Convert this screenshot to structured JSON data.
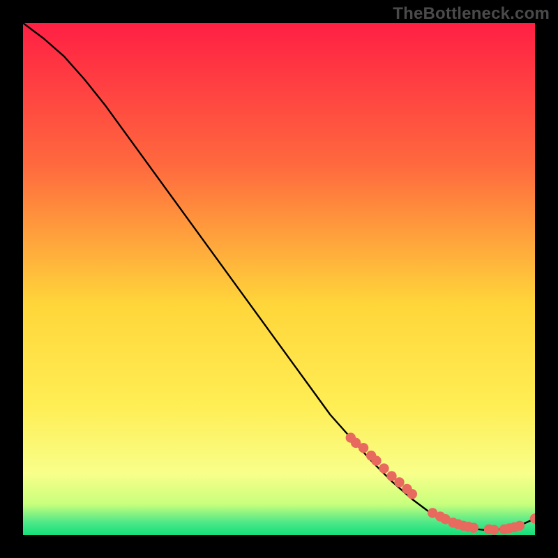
{
  "watermark": "TheBottleneck.com",
  "colors": {
    "gradient_top": "#ff1f44",
    "gradient_mid1": "#ff7a3a",
    "gradient_mid2": "#ffd63a",
    "gradient_mid3": "#fff56a",
    "gradient_bottom_yellow": "#f8ff8a",
    "gradient_green": "#14e07a",
    "curve": "#000000",
    "marker_fill": "#e86a5e",
    "marker_stroke": "#c94f44"
  },
  "chart_data": {
    "type": "line",
    "title": "",
    "xlabel": "",
    "ylabel": "",
    "xlim": [
      0,
      100
    ],
    "ylim": [
      0,
      100
    ],
    "grid": false,
    "legend": false,
    "series": [
      {
        "name": "bottleneck-curve",
        "x": [
          0,
          4,
          8,
          12,
          16,
          20,
          24,
          28,
          32,
          36,
          40,
          44,
          48,
          52,
          56,
          60,
          64,
          68,
          72,
          76,
          80,
          82,
          84,
          86,
          88,
          90,
          92,
          94,
          96,
          98,
          100
        ],
        "y": [
          100,
          97,
          93.5,
          89,
          84,
          78.5,
          73,
          67.5,
          62,
          56.5,
          51,
          45.5,
          40,
          34.5,
          29,
          23.5,
          19,
          14.5,
          10.5,
          7,
          4,
          3,
          2.2,
          1.6,
          1.2,
          1,
          1,
          1.2,
          1.6,
          2.3,
          3.2
        ]
      }
    ],
    "markers": {
      "name": "highlighted-points",
      "x": [
        64,
        65,
        66.5,
        68,
        69,
        70.5,
        72,
        73.5,
        75,
        76,
        80,
        81.5,
        82.5,
        84,
        85,
        86,
        87,
        88,
        91,
        92,
        94,
        95,
        96,
        97,
        100
      ],
      "y": [
        19,
        18,
        17,
        15.5,
        14.5,
        13,
        11.5,
        10.3,
        9,
        8,
        4.3,
        3.6,
        3.1,
        2.4,
        2.1,
        1.8,
        1.6,
        1.4,
        1.1,
        1,
        1.1,
        1.3,
        1.5,
        1.8,
        3.2
      ]
    }
  }
}
